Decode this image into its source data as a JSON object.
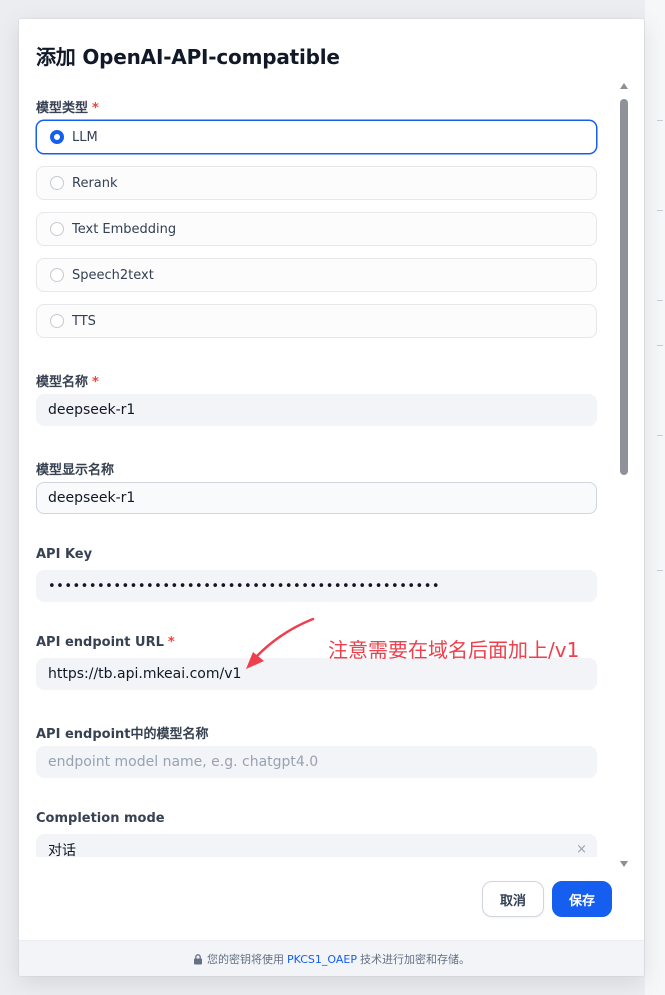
{
  "dialog": {
    "title": "添加 OpenAI-API-compatible"
  },
  "form": {
    "model_type": {
      "label": "模型类型",
      "required_mark": "*",
      "selected": "LLM",
      "options": [
        "LLM",
        "Rerank",
        "Text Embedding",
        "Speech2text",
        "TTS"
      ]
    },
    "model_name": {
      "label": "模型名称",
      "required_mark": "*",
      "value": "deepseek-r1"
    },
    "display_name": {
      "label": "模型显示名称",
      "value": "deepseek-r1"
    },
    "api_key": {
      "label": "API Key",
      "value": "••••••••••••••••••••••••••••••••••••••••••••••••"
    },
    "endpoint_url": {
      "label": "API endpoint URL",
      "required_mark": "*",
      "value": "https://tb.api.mkeai.com/v1"
    },
    "endpoint_model_name": {
      "label": "API endpoint中的模型名称",
      "placeholder": "endpoint model name, e.g. chatgpt4.0"
    },
    "completion_mode": {
      "label": "Completion mode",
      "value": "对话",
      "clear_symbol": "×"
    }
  },
  "annotation": {
    "text": "注意需要在域名后面加上/v1",
    "color": "#ee3f4d"
  },
  "buttons": {
    "cancel": "取消",
    "save": "保存"
  },
  "footer": {
    "prefix": "您的密钥将使用",
    "link": "PKCS1_OAEP",
    "suffix": "技术进行加密和存储。",
    "icon": "lock-icon"
  },
  "colors": {
    "accent": "#155eef",
    "required": "#f04438"
  }
}
